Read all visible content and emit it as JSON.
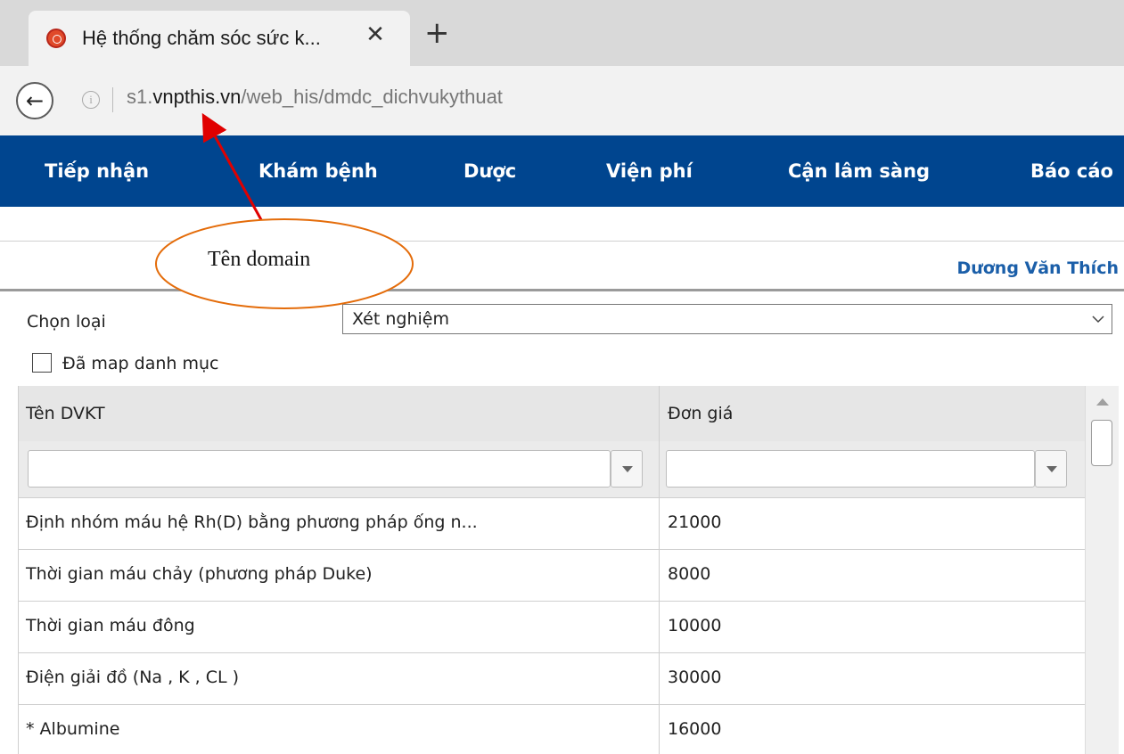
{
  "browser": {
    "tab_title": "Hệ thống chăm sóc sức k...",
    "close_glyph": "✕",
    "new_tab_glyph": "+",
    "back_glyph": "←",
    "info_glyph": "i",
    "url_prefix": "s1.",
    "url_domain": "vnpthis.vn",
    "url_path": "/web_his/dmdc_dichvukythuat"
  },
  "nav": {
    "items": [
      "Tiếp nhận",
      "Khám bệnh",
      "Dược",
      "Viện phí",
      "Cận lâm sàng",
      "Báo cáo"
    ]
  },
  "user": {
    "name": "Dương Văn Thích"
  },
  "form": {
    "type_label": "Chọn loại",
    "type_value": "Xét nghiệm",
    "mapped_label": "Đã map danh mục",
    "mapped_checked": false
  },
  "grid": {
    "columns": [
      "Tên DVKT",
      "Đơn giá"
    ],
    "rows": [
      {
        "name": "Định nhóm máu hệ Rh(D) bằng phương pháp ống n...",
        "price": "21000"
      },
      {
        "name": "Thời gian máu chảy (phương pháp Duke)",
        "price": "8000"
      },
      {
        "name": "Thời gian máu đông",
        "price": "10000"
      },
      {
        "name": "Điện giải đồ (Na , K , CL )",
        "price": "30000"
      },
      {
        "name": "* Albumine",
        "price": "16000"
      }
    ]
  },
  "annotation": {
    "text": "Tên domain",
    "color": "#e46c0a",
    "arrow_color": "#e00000"
  },
  "colors": {
    "nav_bg": "#00458f",
    "user_name": "#1b5fa9"
  }
}
